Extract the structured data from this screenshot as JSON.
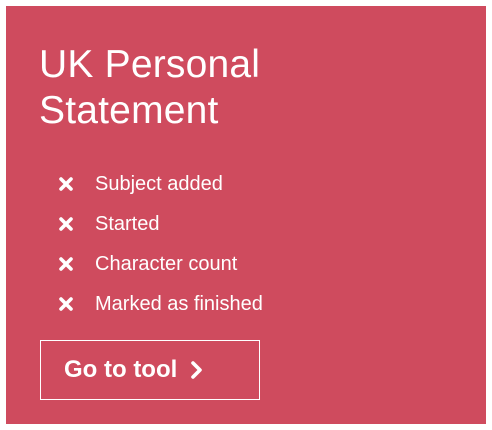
{
  "card": {
    "title": "UK Personal Statement",
    "background_color": "#cf4b5e",
    "checklist": [
      {
        "label": "Subject added",
        "icon": "x-icon"
      },
      {
        "label": "Started",
        "icon": "x-icon"
      },
      {
        "label": "Character count",
        "icon": "x-icon"
      },
      {
        "label": "Marked as finished",
        "icon": "x-icon"
      }
    ],
    "button": {
      "label": "Go to tool",
      "icon": "chevron-right-icon"
    }
  }
}
